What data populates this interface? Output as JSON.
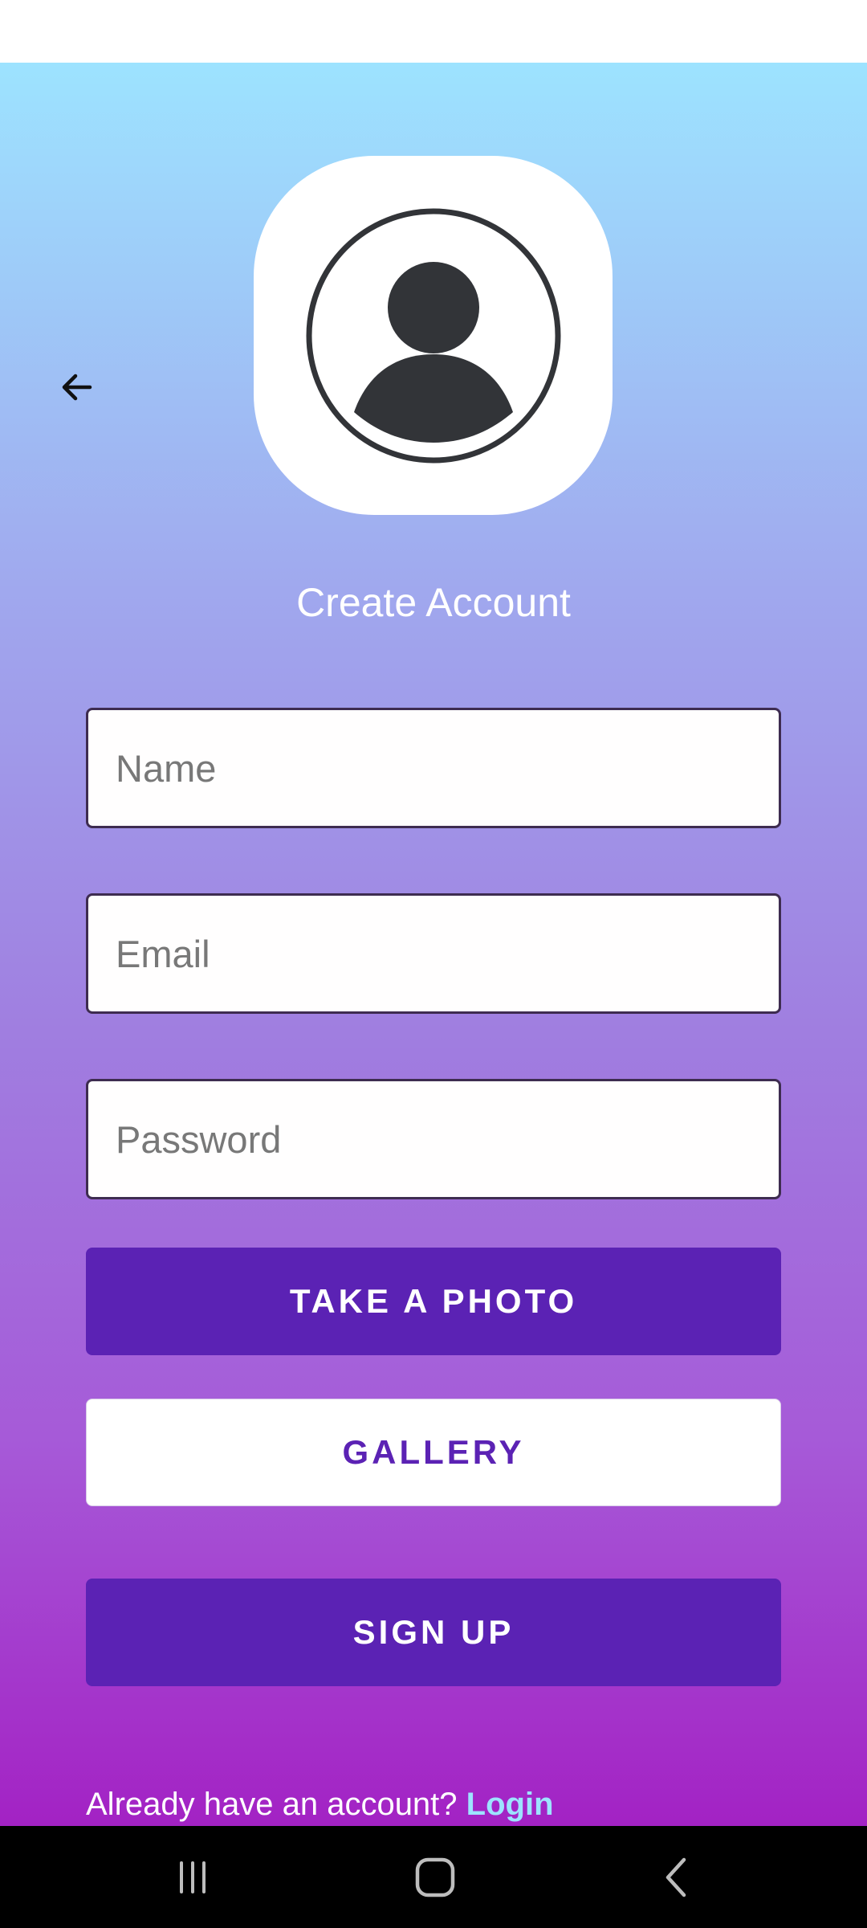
{
  "header": {
    "back_icon": "arrow-left-icon",
    "avatar_icon": "user-avatar-icon"
  },
  "title": "Create Account",
  "form": {
    "name_placeholder": "Name",
    "email_placeholder": "Email",
    "password_placeholder": "Password"
  },
  "buttons": {
    "take_photo": "TAKE A PHOTO",
    "gallery": "GALLERY",
    "sign_up": "SIGN UP"
  },
  "footer": {
    "prompt": "Already have an account? ",
    "login_link": "Login"
  },
  "nav_bar": {
    "recents_icon": "recents-icon",
    "home_icon": "home-icon",
    "back_icon": "chevron-left-icon"
  },
  "colors": {
    "gradient_top": "#9de3ff",
    "gradient_bottom": "#a322c4",
    "primary_button": "#5b22b4",
    "link": "#9de3ff"
  }
}
